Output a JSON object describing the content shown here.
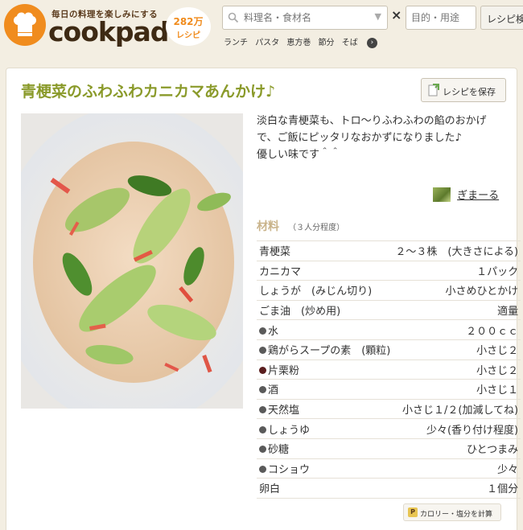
{
  "header": {
    "tagline": "毎日の料理を楽しみにする",
    "brand": "cookpad",
    "recipe_count": "282万",
    "recipe_unit": "レシピ",
    "search_placeholder": "料理名・食材名",
    "cross": "×",
    "purpose_placeholder": "目的・用途",
    "search_button": "レシピ検",
    "keywords": [
      "ランチ",
      "パスタ",
      "恵方巻",
      "節分",
      "そば"
    ]
  },
  "recipe": {
    "title": "青梗菜のふわふわカニカマあんかけ♪",
    "save_label": "レシピを保存",
    "description": [
      "淡白な青梗菜も、トロ～りふわふわの餡のおかげで、ご飯にピッタリなおかずになりました♪",
      "優しい味です＾＾"
    ],
    "author": "ぎまーる",
    "ingredients_label": "材料",
    "servings": "（３人分程度）",
    "ingredients": [
      {
        "name": "青梗菜",
        "qty": "２～３株　(大きさによる)",
        "dot": ""
      },
      {
        "name": "カニカマ",
        "qty": "１パック",
        "dot": ""
      },
      {
        "name": "しょうが　(みじん切り)",
        "qty": "小さめひとかけ",
        "dot": ""
      },
      {
        "name": "ごま油　(炒め用)",
        "qty": "適量",
        "dot": ""
      },
      {
        "name": "水",
        "qty": "２００ｃｃ",
        "dot": "gray"
      },
      {
        "name": "鶏がらスープの素　(顆粒)",
        "qty": "小さじ２",
        "dot": "gray"
      },
      {
        "name": "片栗粉",
        "qty": "小さじ２",
        "dot": "dark"
      },
      {
        "name": "酒",
        "qty": "小さじ１",
        "dot": "gray"
      },
      {
        "name": "天然塩",
        "qty": "小さじ１/２(加減してね)",
        "dot": "gray"
      },
      {
        "name": "しょうゆ",
        "qty": "少々(香り付け程度)",
        "dot": "gray"
      },
      {
        "name": "砂糖",
        "qty": "ひとつまみ",
        "dot": "gray"
      },
      {
        "name": "コショウ",
        "qty": "少々",
        "dot": "gray"
      },
      {
        "name": "卵白",
        "qty": "１個分",
        "dot": ""
      }
    ],
    "calorie_label": "カロリー・塩分を計算"
  },
  "colors": {
    "brand_orange": "#f08c1e",
    "title_green": "#8a9a2a",
    "background": "#f3eee2"
  }
}
